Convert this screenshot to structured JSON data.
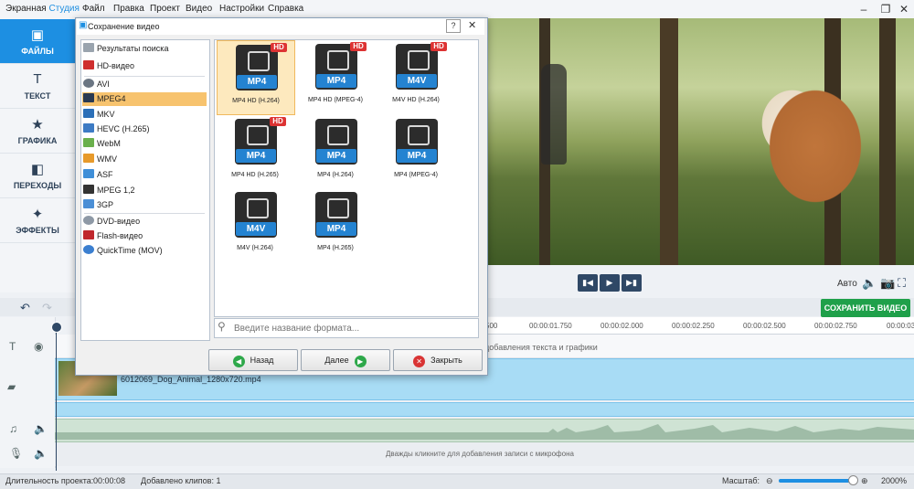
{
  "app": {
    "title_main": "Экранная ",
    "title_accent": "Студия"
  },
  "menu": [
    "Файл",
    "Правка",
    "Проект",
    "Видео",
    "Настройки",
    "Справка"
  ],
  "sidebar": [
    {
      "label": "ФАЙЛЫ",
      "icon": "files-icon",
      "glyph": "▣"
    },
    {
      "label": "ТЕКСТ",
      "icon": "text-icon",
      "glyph": "T"
    },
    {
      "label": "ГРАФИКА",
      "icon": "star-icon",
      "glyph": "★"
    },
    {
      "label": "ПЕРЕХОДЫ",
      "icon": "transitions-icon",
      "glyph": "◧"
    },
    {
      "label": "ЭФФЕКТЫ",
      "icon": "magic-wand-icon",
      "glyph": "✦"
    }
  ],
  "dialog": {
    "title": "Сохранение видео",
    "help": "?",
    "formats": [
      {
        "label": "Результаты поиска",
        "icon": "search-results-icon"
      },
      {
        "label": "HD-видео",
        "icon": "hd-icon"
      },
      {
        "label": "AVI",
        "icon": "avi-icon"
      },
      {
        "label": "MPEG4",
        "icon": "mpeg4-icon",
        "selected": true
      },
      {
        "label": "MKV",
        "icon": "mkv-icon"
      },
      {
        "label": "HEVC (H.265)",
        "icon": "hevc-icon"
      },
      {
        "label": "WebM",
        "icon": "webm-icon"
      },
      {
        "label": "WMV",
        "icon": "wmv-icon"
      },
      {
        "label": "ASF",
        "icon": "asf-icon"
      },
      {
        "label": "MPEG 1,2",
        "icon": "mpeg12-icon"
      },
      {
        "label": "3GP",
        "icon": "3gp-icon"
      },
      {
        "label": "DVD-видео",
        "icon": "dvd-icon"
      },
      {
        "label": "Flash-видео",
        "icon": "flash-icon"
      },
      {
        "label": "QuickTime (MOV)",
        "icon": "quicktime-icon"
      }
    ],
    "presets": [
      {
        "badge": "MP4",
        "hd": "HD",
        "caption": "MP4 HD (H.264)",
        "selected": true
      },
      {
        "badge": "MP4",
        "hd": "HD",
        "caption": "MP4 HD (MPEG-4)"
      },
      {
        "badge": "M4V",
        "hd": "HD",
        "caption": "M4V HD (H.264)"
      },
      {
        "badge": "MP4",
        "hd": "HD",
        "caption": "MP4 HD (H.265)"
      },
      {
        "badge": "MP4",
        "hd": "",
        "caption": "MP4 (H.264)"
      },
      {
        "badge": "MP4",
        "hd": "",
        "caption": "MP4 (MPEG-4)"
      },
      {
        "badge": "M4V",
        "hd": "",
        "caption": "M4V (H.264)"
      },
      {
        "badge": "MP4",
        "hd": "",
        "caption": "MP4 (H.265)"
      }
    ],
    "search_placeholder": "Введите название формата...",
    "buttons": {
      "back": "Назад",
      "next": "Далее",
      "close": "Закрыть"
    }
  },
  "player": {
    "auto": "Авто",
    "save_video": "СОХРАНИТЬ ВИДЕО"
  },
  "timeline": {
    "ticks": [
      "500",
      "00:00:01.750",
      "00:00:02.000",
      "00:00:02.250",
      "00:00:02.500",
      "00:00:02.750",
      "00:00:03"
    ],
    "text_hint": "добавления текста и графики",
    "clip_name": "6012069_Dog_Animal_1280x720.mp4",
    "mic_hint": "Дважды кликните для добавления записи с микрофона"
  },
  "status": {
    "duration_label": "Длительность проекта:",
    "duration": "00:00:08",
    "clips": "Добавлено клипов: 1",
    "zoom_label": "Масштаб:",
    "zoom": "2000%",
    "zoom_level": 0.97
  },
  "colors": {
    "accent": "#1d8fe2",
    "save": "#1fa04a",
    "selection": "#f7c36e"
  }
}
